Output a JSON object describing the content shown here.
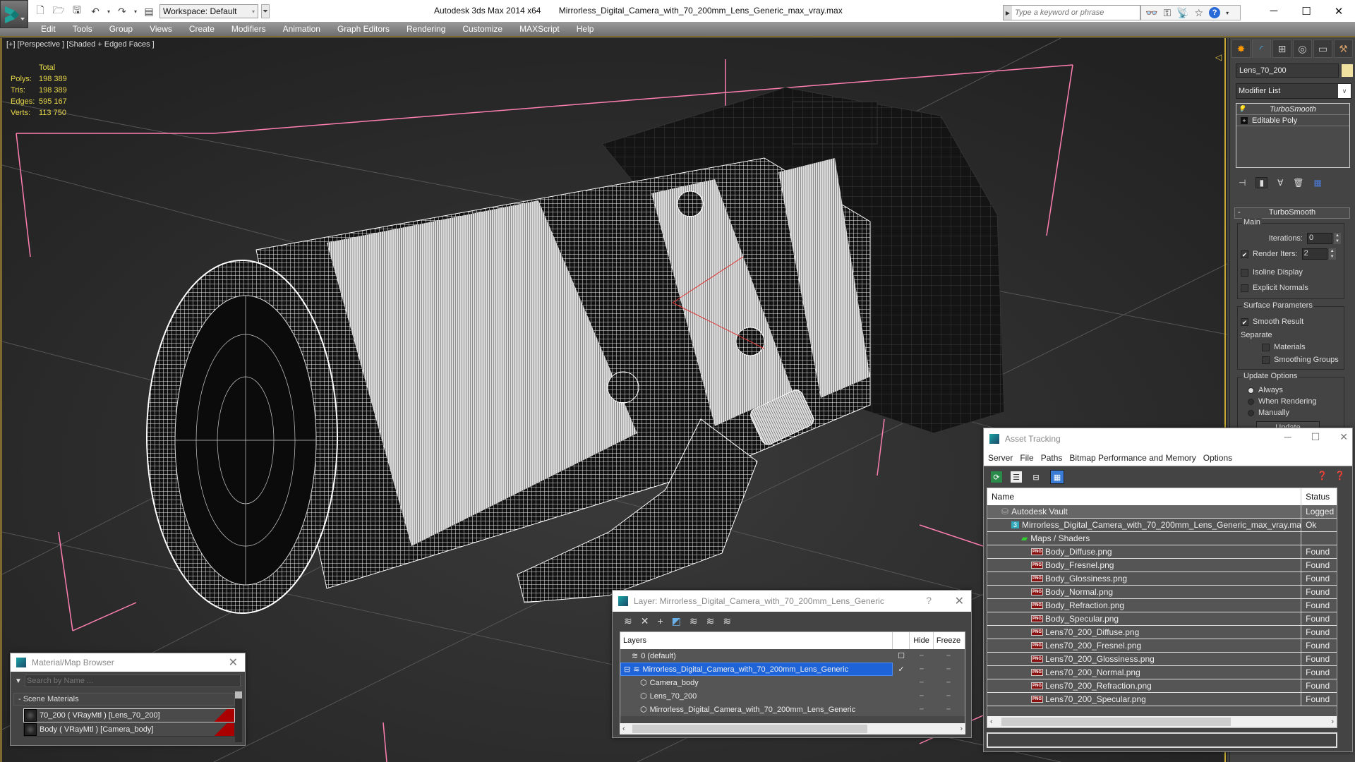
{
  "titlebar": {
    "app_name": "Autodesk 3ds Max  2014 x64",
    "file_name": "Mirrorless_Digital_Camera_with_70_200mm_Lens_Generic_max_vray.max",
    "workspace": "Workspace: Default",
    "search_placeholder": "Type a keyword or phrase",
    "icons": [
      "binoculars-icon",
      "key-icon",
      "satellite-icon",
      "star-icon",
      "help-icon"
    ]
  },
  "menu": [
    "Edit",
    "Tools",
    "Group",
    "Views",
    "Create",
    "Modifiers",
    "Animation",
    "Graph Editors",
    "Rendering",
    "Customize",
    "MAXScript",
    "Help"
  ],
  "viewport": {
    "label": "[+] [Perspective ] [Shaded + Edged Faces ]",
    "stats": {
      "header": "Total",
      "rows": [
        {
          "key": "Polys:",
          "value": "198 389"
        },
        {
          "key": "Tris:",
          "value": "198 389"
        },
        {
          "key": "Edges:",
          "value": "595 167"
        },
        {
          "key": "Verts:",
          "value": "113 750"
        }
      ]
    }
  },
  "command_panel": {
    "object_name": "Lens_70_200",
    "object_color": "#f0e1a0",
    "modifier_list": "Modifier List",
    "stack": [
      "TurboSmooth",
      "Editable Poly"
    ],
    "rollout_title": "TurboSmooth",
    "main": {
      "title": "Main",
      "iterations_label": "Iterations:",
      "iterations_value": "0",
      "render_iters_label": "Render Iters:",
      "render_iters_value": "2",
      "render_iters_checked": true,
      "isoline_label": "Isoline Display",
      "explicit_label": "Explicit Normals"
    },
    "surface": {
      "title": "Surface Parameters",
      "smooth_result": "Smooth Result",
      "separate": "Separate",
      "materials": "Materials",
      "smoothing_groups": "Smoothing Groups"
    },
    "update": {
      "title": "Update Options",
      "options": [
        "Always",
        "When Rendering",
        "Manually"
      ],
      "selected": "Always",
      "button": "Update"
    }
  },
  "asset_tracking": {
    "title": "Asset Tracking",
    "menu": [
      "Server",
      "File",
      "Paths",
      "Bitmap Performance and Memory",
      "Options"
    ],
    "columns": [
      "Name",
      "Status"
    ],
    "rows": [
      {
        "name": "Autodesk Vault",
        "status": "Logged O",
        "indent": 1,
        "icon": "vault-icon"
      },
      {
        "name": "Mirrorless_Digital_Camera_with_70_200mm_Lens_Generic_max_vray.max",
        "status": "Ok",
        "indent": 2,
        "icon": "max-file-icon"
      },
      {
        "name": "Maps / Shaders",
        "status": "",
        "indent": 3,
        "icon": "maps-icon"
      },
      {
        "name": "Body_Diffuse.png",
        "status": "Found",
        "indent": 4,
        "icon": "png-icon"
      },
      {
        "name": "Body_Fresnel.png",
        "status": "Found",
        "indent": 4,
        "icon": "png-icon"
      },
      {
        "name": "Body_Glossiness.png",
        "status": "Found",
        "indent": 4,
        "icon": "png-icon"
      },
      {
        "name": "Body_Normal.png",
        "status": "Found",
        "indent": 4,
        "icon": "png-icon"
      },
      {
        "name": "Body_Refraction.png",
        "status": "Found",
        "indent": 4,
        "icon": "png-icon"
      },
      {
        "name": "Body_Specular.png",
        "status": "Found",
        "indent": 4,
        "icon": "png-icon"
      },
      {
        "name": "Lens70_200_Diffuse.png",
        "status": "Found",
        "indent": 4,
        "icon": "png-icon"
      },
      {
        "name": "Lens70_200_Fresnel.png",
        "status": "Found",
        "indent": 4,
        "icon": "png-icon"
      },
      {
        "name": "Lens70_200_Glossiness.png",
        "status": "Found",
        "indent": 4,
        "icon": "png-icon"
      },
      {
        "name": "Lens70_200_Normal.png",
        "status": "Found",
        "indent": 4,
        "icon": "png-icon"
      },
      {
        "name": "Lens70_200_Refraction.png",
        "status": "Found",
        "indent": 4,
        "icon": "png-icon"
      },
      {
        "name": "Lens70_200_Specular.png",
        "status": "Found",
        "indent": 4,
        "icon": "png-icon"
      }
    ],
    "png_label": "PNG"
  },
  "layer_dialog": {
    "title": "Layer: Mirrorless_Digital_Camera_with_70_200mm_Lens_Generic",
    "columns": {
      "layers": "Layers",
      "hide": "Hide",
      "freeze": "Freeze"
    },
    "rows": [
      {
        "name": "0 (default)",
        "type": "layer",
        "selected": false,
        "indent": 1,
        "current": "box"
      },
      {
        "name": "Mirrorless_Digital_Camera_with_70_200mm_Lens_Generic",
        "type": "layer",
        "selected": true,
        "indent": 0,
        "current": "check"
      },
      {
        "name": "Camera_body",
        "type": "object",
        "selected": false,
        "indent": 2,
        "current": ""
      },
      {
        "name": "Lens_70_200",
        "type": "object",
        "selected": false,
        "indent": 2,
        "current": ""
      },
      {
        "name": "Mirrorless_Digital_Camera_with_70_200mm_Lens_Generic",
        "type": "object",
        "selected": false,
        "indent": 2,
        "current": ""
      }
    ]
  },
  "material_browser": {
    "title": "Material/Map Browser",
    "search_placeholder": "Search by Name ...",
    "section": "- Scene Materials",
    "items": [
      {
        "label": "70_200  ( VRayMtl ) [Lens_70_200]",
        "selected": true
      },
      {
        "label": "Body  ( VRayMtl ) [Camera_body]",
        "selected": false
      }
    ]
  },
  "colors": {
    "viewport_bg": "#2b2b2b",
    "stats_text": "#e8d84a",
    "selection_blue": "#1e64d8",
    "active_border": "#c9a934",
    "bbox_pink": "#ff7fb0"
  }
}
